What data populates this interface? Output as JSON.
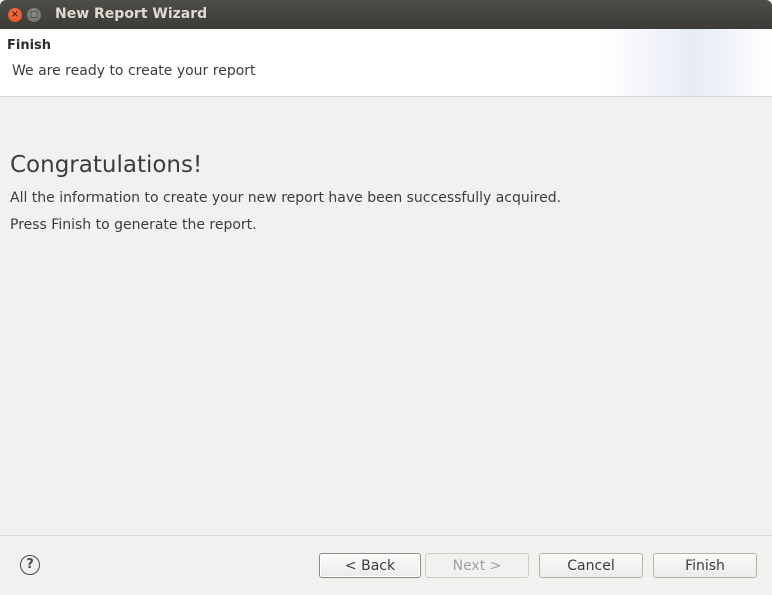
{
  "window": {
    "title": "New Report Wizard",
    "close_glyph": "×",
    "minimize_glyph": "◻"
  },
  "header": {
    "title": "Finish",
    "description": "We are ready to create your report"
  },
  "main": {
    "heading": "Congratulations!",
    "line1": "All the information to create your new report have been successfully acquired.",
    "line2": "Press Finish to generate the report."
  },
  "footer": {
    "help_icon": "question-mark-circle",
    "help_glyph": "?",
    "back_label": "< Back",
    "next_label": "Next >",
    "cancel_label": "Cancel",
    "finish_label": "Finish"
  },
  "colors": {
    "titlebar": "#3c3b37",
    "close_button": "#df4a16",
    "background": "#f2f1f0"
  }
}
